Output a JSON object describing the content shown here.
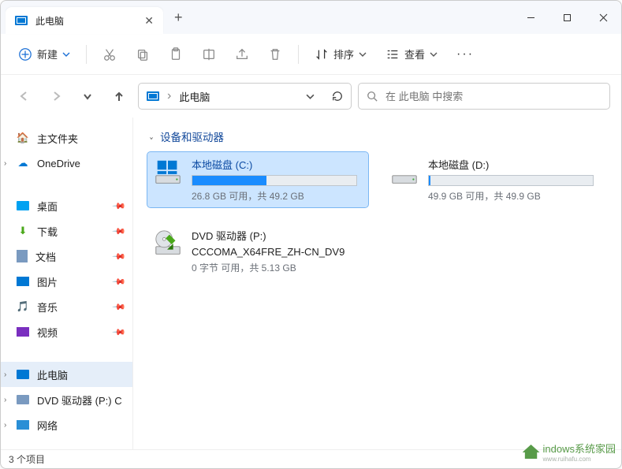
{
  "titlebar": {
    "tab_title": "此电脑",
    "close_glyph": "✕",
    "new_tab_glyph": "+"
  },
  "toolbar": {
    "new_label": "新建",
    "sort_label": "排序",
    "view_label": "查看"
  },
  "nav": {
    "crumb": "此电脑",
    "search_placeholder": "在 此电脑 中搜索"
  },
  "sidebar": {
    "home": "主文件夹",
    "onedrive": "OneDrive",
    "desktop": "桌面",
    "downloads": "下载",
    "documents": "文档",
    "pictures": "图片",
    "music": "音乐",
    "videos": "视频",
    "this_pc": "此电脑",
    "dvd": "DVD 驱动器 (P:) C",
    "network": "网络"
  },
  "main": {
    "group_title": "设备和驱动器",
    "drives": [
      {
        "title": "本地磁盘 (C:)",
        "sub": "26.8 GB 可用，共 49.2 GB",
        "used_pct": 45,
        "selected": true,
        "type": "os"
      },
      {
        "title": "本地磁盘 (D:)",
        "sub": "49.9 GB 可用，共 49.9 GB",
        "used_pct": 1,
        "selected": false,
        "type": "hdd"
      },
      {
        "title": "DVD 驱动器 (P:)",
        "title2": "CCCOMA_X64FRE_ZH-CN_DV9",
        "sub": "0 字节 可用，共 5.13 GB",
        "selected": false,
        "type": "dvd"
      }
    ]
  },
  "status": {
    "text": "3 个项目"
  },
  "badge": {
    "text": "indows系统家园",
    "url": "www.ruihafu.com"
  },
  "colors": {
    "accent": "#0078d4",
    "link": "#13499b"
  }
}
